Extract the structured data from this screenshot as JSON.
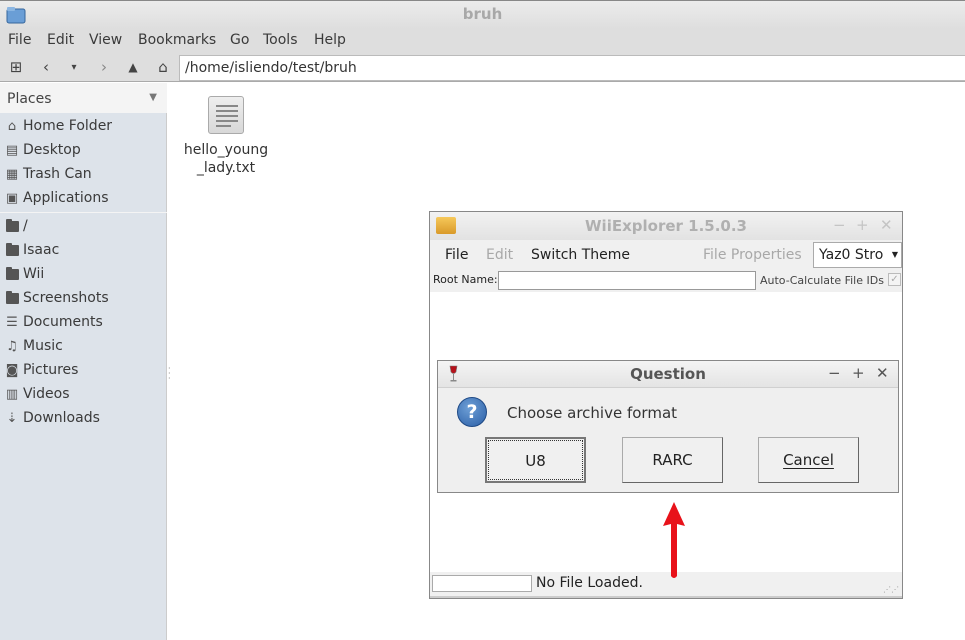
{
  "window": {
    "title": "bruh"
  },
  "menubar": [
    "File",
    "Edit",
    "View",
    "Bookmarks",
    "Go",
    "Tools",
    "Help"
  ],
  "toolbar": {
    "path": "/home/isliendo/test/bruh"
  },
  "sidebar": {
    "header": "Places",
    "items": [
      {
        "label": "Home Folder",
        "icon": "home-icon"
      },
      {
        "label": "Desktop",
        "icon": "desktop-icon"
      },
      {
        "label": "Trash Can",
        "icon": "trash-icon"
      },
      {
        "label": "Applications",
        "icon": "applications-icon"
      },
      {
        "label": "/",
        "icon": "folder-icon"
      },
      {
        "label": "Isaac",
        "icon": "folder-icon"
      },
      {
        "label": "Wii",
        "icon": "folder-icon"
      },
      {
        "label": "Screenshots",
        "icon": "folder-icon"
      },
      {
        "label": "Documents",
        "icon": "documents-icon"
      },
      {
        "label": "Music",
        "icon": "music-icon"
      },
      {
        "label": "Pictures",
        "icon": "pictures-icon"
      },
      {
        "label": "Videos",
        "icon": "videos-icon"
      },
      {
        "label": "Downloads",
        "icon": "downloads-icon"
      }
    ]
  },
  "files": [
    {
      "name": "hello_young\n_lady.txt",
      "line1": "hello_young",
      "line2": "_lady.txt"
    }
  ],
  "wiiexplorer": {
    "title": "WiiExplorer 1.5.0.3",
    "menu": {
      "file": "File",
      "edit": "Edit",
      "switch_theme": "Switch Theme",
      "file_properties": "File Properties"
    },
    "compression": "Yaz0 Stro",
    "root_name_label": "Root Name:",
    "root_name_value": "",
    "auto_calc_label": "Auto-Calculate File IDs",
    "auto_calc_checked": true,
    "status": "No File Loaded."
  },
  "dialog": {
    "title": "Question",
    "message": "Choose archive format",
    "buttons": {
      "u8": "U8",
      "rarc": "RARC",
      "cancel": "Cancel"
    }
  },
  "colors": {
    "annotation_arrow": "#e8121a",
    "question_icon": "#2a5ea6"
  }
}
